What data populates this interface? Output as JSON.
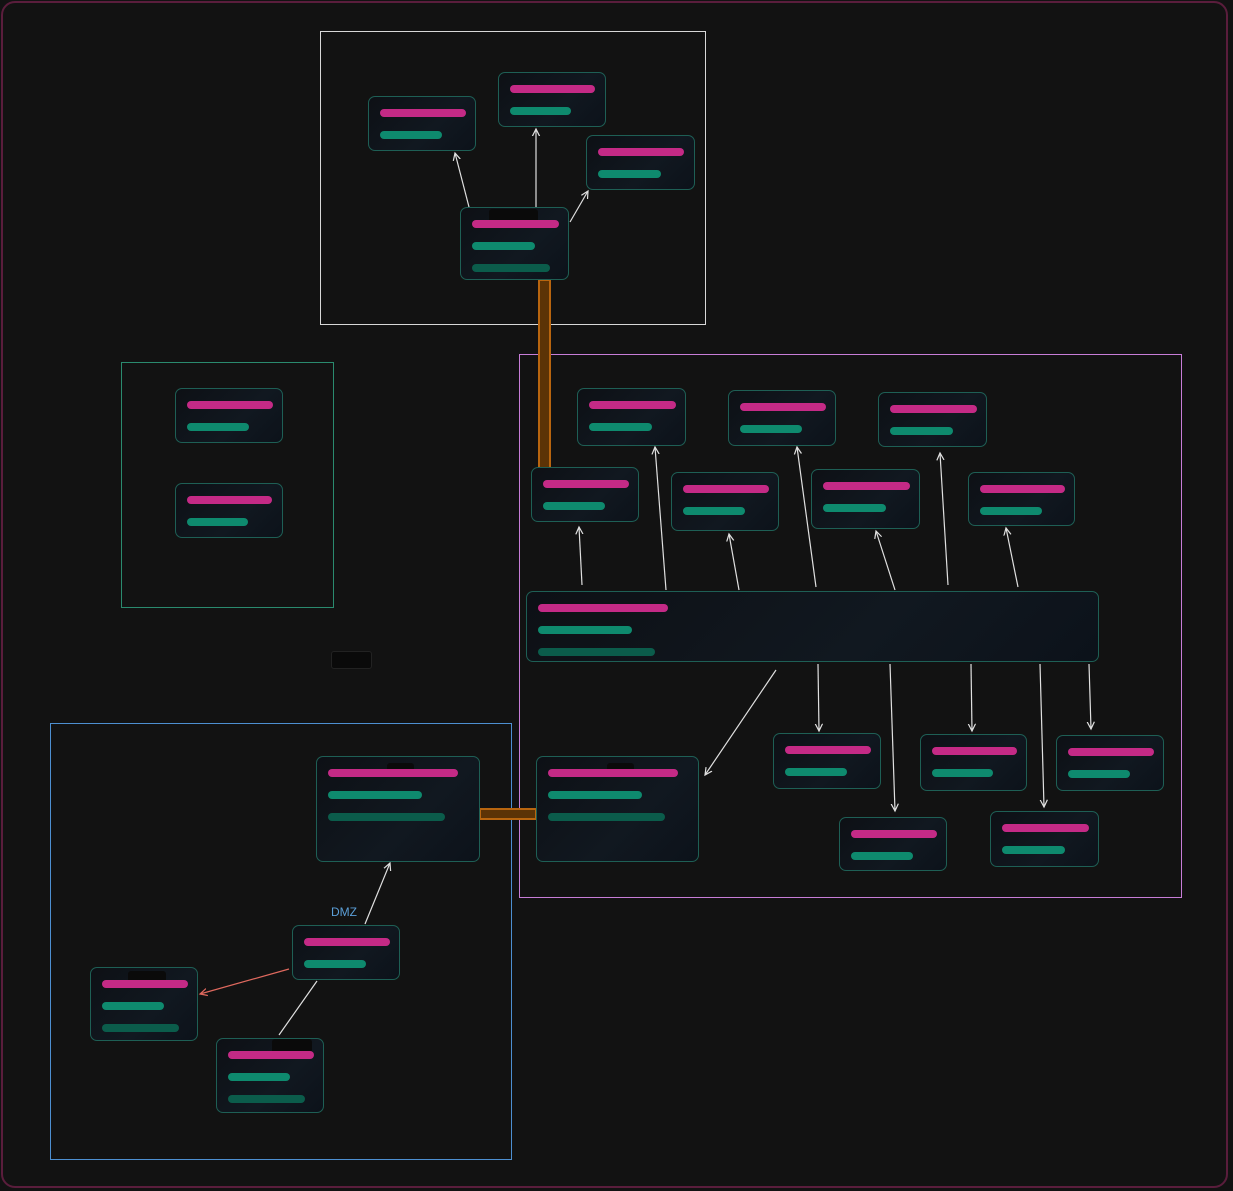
{
  "colors": {
    "background": "#121212",
    "frame": "#5a1d3c",
    "node_border": "#1e5f55",
    "bar_pink": "#c42a86",
    "bar_green": "#0e8a6e",
    "bar_dark": "#0b5c4b",
    "group_top": "#d8d8d8",
    "group_green": "#2a8a6e",
    "group_purple": "#c77dd8",
    "group_blue": "#4d8fd1",
    "edge": "#e0e0e0",
    "edge_red": "#e0695e",
    "connector_orange": "#b8650f"
  },
  "diagram": {
    "edge_label_dmz": "DMZ"
  }
}
